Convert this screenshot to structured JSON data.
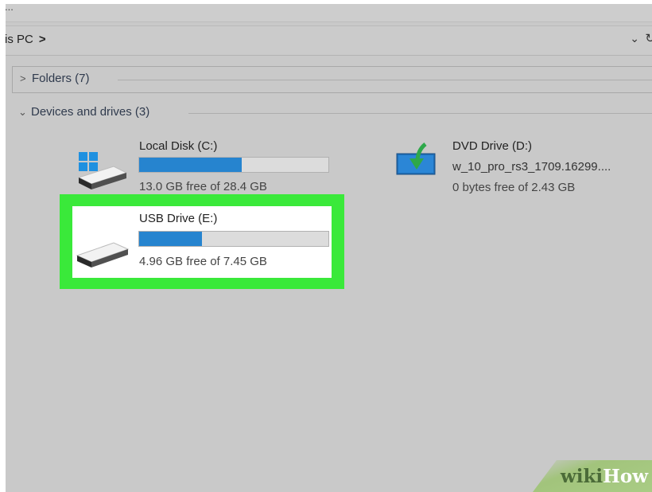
{
  "window": {
    "top_ellipsis": "..."
  },
  "address_bar": {
    "path": "is PC",
    "separator": ">",
    "dropdown_glyph": "⌄",
    "refresh_glyph": "↻"
  },
  "groups": {
    "folders": {
      "label": "Folders (7)",
      "expanded": false,
      "chevron": ">"
    },
    "devices": {
      "label": "Devices and drives (3)",
      "expanded": true,
      "chevron": "⌄"
    }
  },
  "drives": [
    {
      "name": "Local Disk (C:)",
      "space": "13.0 GB free of 28.4 GB",
      "used_percent": 54,
      "icon": "windows-drive-icon"
    },
    {
      "name": "USB Drive (E:)",
      "space": "4.96 GB free of 7.45 GB",
      "used_percent": 33,
      "icon": "usb-drive-icon",
      "highlighted": true
    },
    {
      "name": "DVD Drive (D:)",
      "label": "w_10_pro_rs3_1709.16299....",
      "space": "0 bytes free of 2.43 GB",
      "icon": "dvd-drive-icon"
    }
  ],
  "colors": {
    "bar_fill": "#2684cf",
    "highlight": "#3ae93a",
    "background": "#c9c9c9"
  },
  "watermark": {
    "part1": "wiki",
    "part2": "How"
  }
}
